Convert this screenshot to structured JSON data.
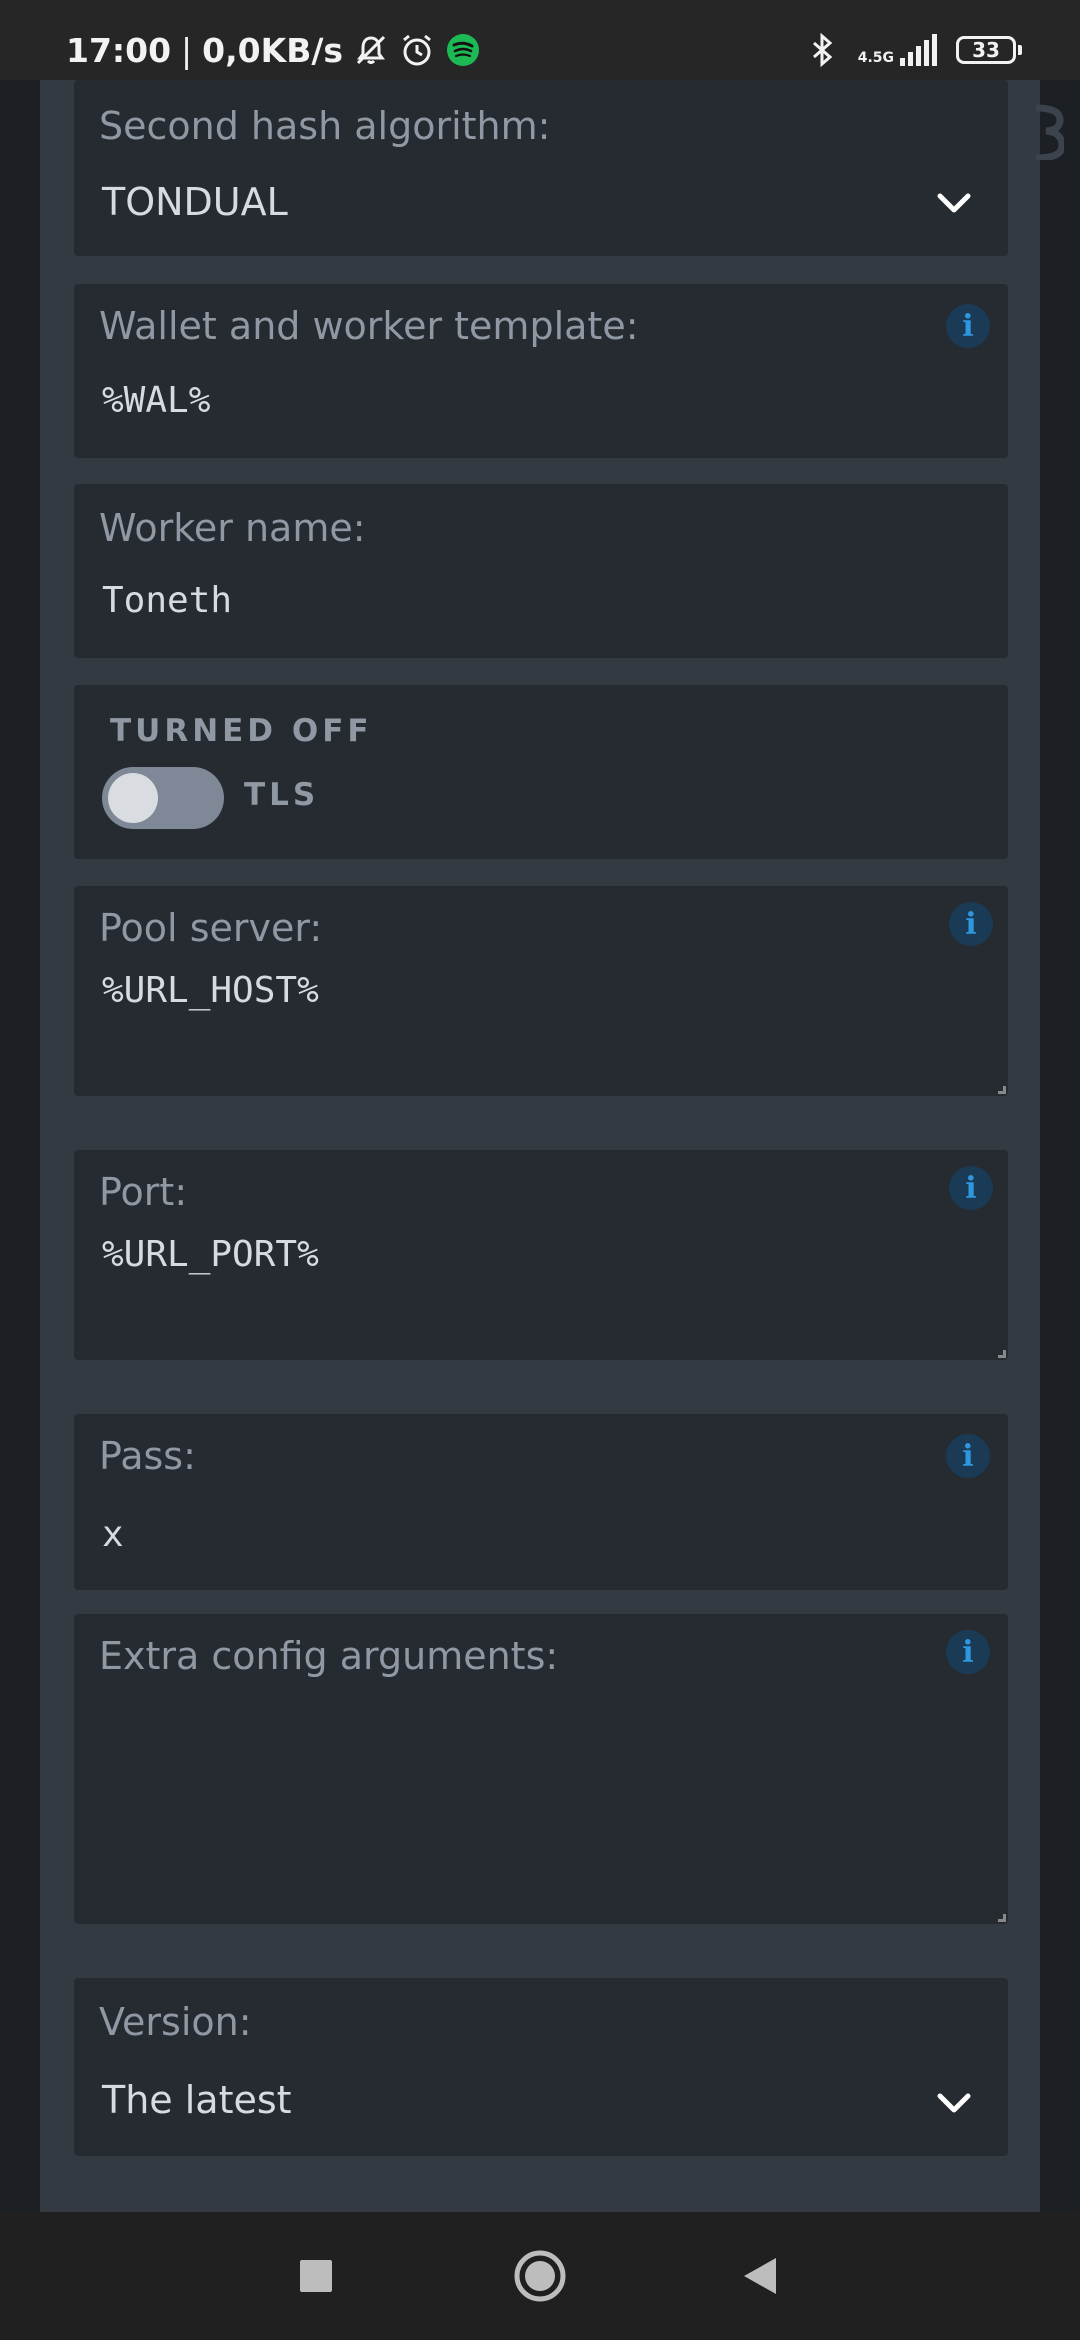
{
  "status_bar": {
    "time": "17:00",
    "separator": "|",
    "speed": "0,0KB/s",
    "network": "4.5G",
    "battery": "33"
  },
  "form": {
    "second_hash": {
      "label": "Second hash algorithm:",
      "value": "TONDUAL"
    },
    "wallet_template": {
      "label": "Wallet and worker template:",
      "value": "%WAL%"
    },
    "worker_name": {
      "label": "Worker name:",
      "value": "Toneth"
    },
    "tls": {
      "state": "TURNED OFF",
      "label": "TLS",
      "enabled": false
    },
    "pool_server": {
      "label": "Pool server:",
      "value": "%URL_HOST%"
    },
    "port": {
      "label": "Port:",
      "value": "%URL_PORT%"
    },
    "pass": {
      "label": "Pass:",
      "value": "x"
    },
    "extra_config": {
      "label": "Extra config arguments:",
      "value": ""
    },
    "version": {
      "label": "Version:",
      "value": "The latest"
    },
    "info_symbol": "i"
  },
  "colors": {
    "panel": "#343a42",
    "card": "#262a31",
    "label": "#8f98a3",
    "info_accent": "#2f97e0",
    "toggle_off": "#7e8896"
  },
  "icons": {
    "status": [
      "mute-notifications-icon",
      "alarm-icon",
      "spotify-icon",
      "bluetooth-icon",
      "signal-icon",
      "battery-icon"
    ],
    "nav": [
      "recents-square-icon",
      "home-circle-icon",
      "back-triangle-icon"
    ],
    "field": [
      "chevron-down-icon",
      "info-icon"
    ]
  }
}
